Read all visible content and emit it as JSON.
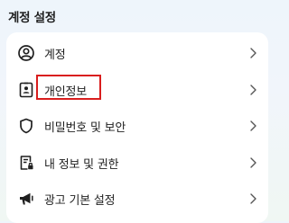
{
  "section_title": "계정 설정",
  "items": [
    {
      "label": "계정",
      "icon": "account-circle-icon"
    },
    {
      "label": "개인정보",
      "icon": "id-card-icon"
    },
    {
      "label": "비밀번호 및 보안",
      "icon": "shield-icon"
    },
    {
      "label": "내 정보 및 권한",
      "icon": "document-lock-icon"
    },
    {
      "label": "광고 기본 설정",
      "icon": "megaphone-icon"
    }
  ],
  "highlighted_item": "개인정보",
  "colors": {
    "highlight_border": "#d91e1e",
    "card_background": "#ffffff",
    "page_background": "#eef4fa"
  }
}
